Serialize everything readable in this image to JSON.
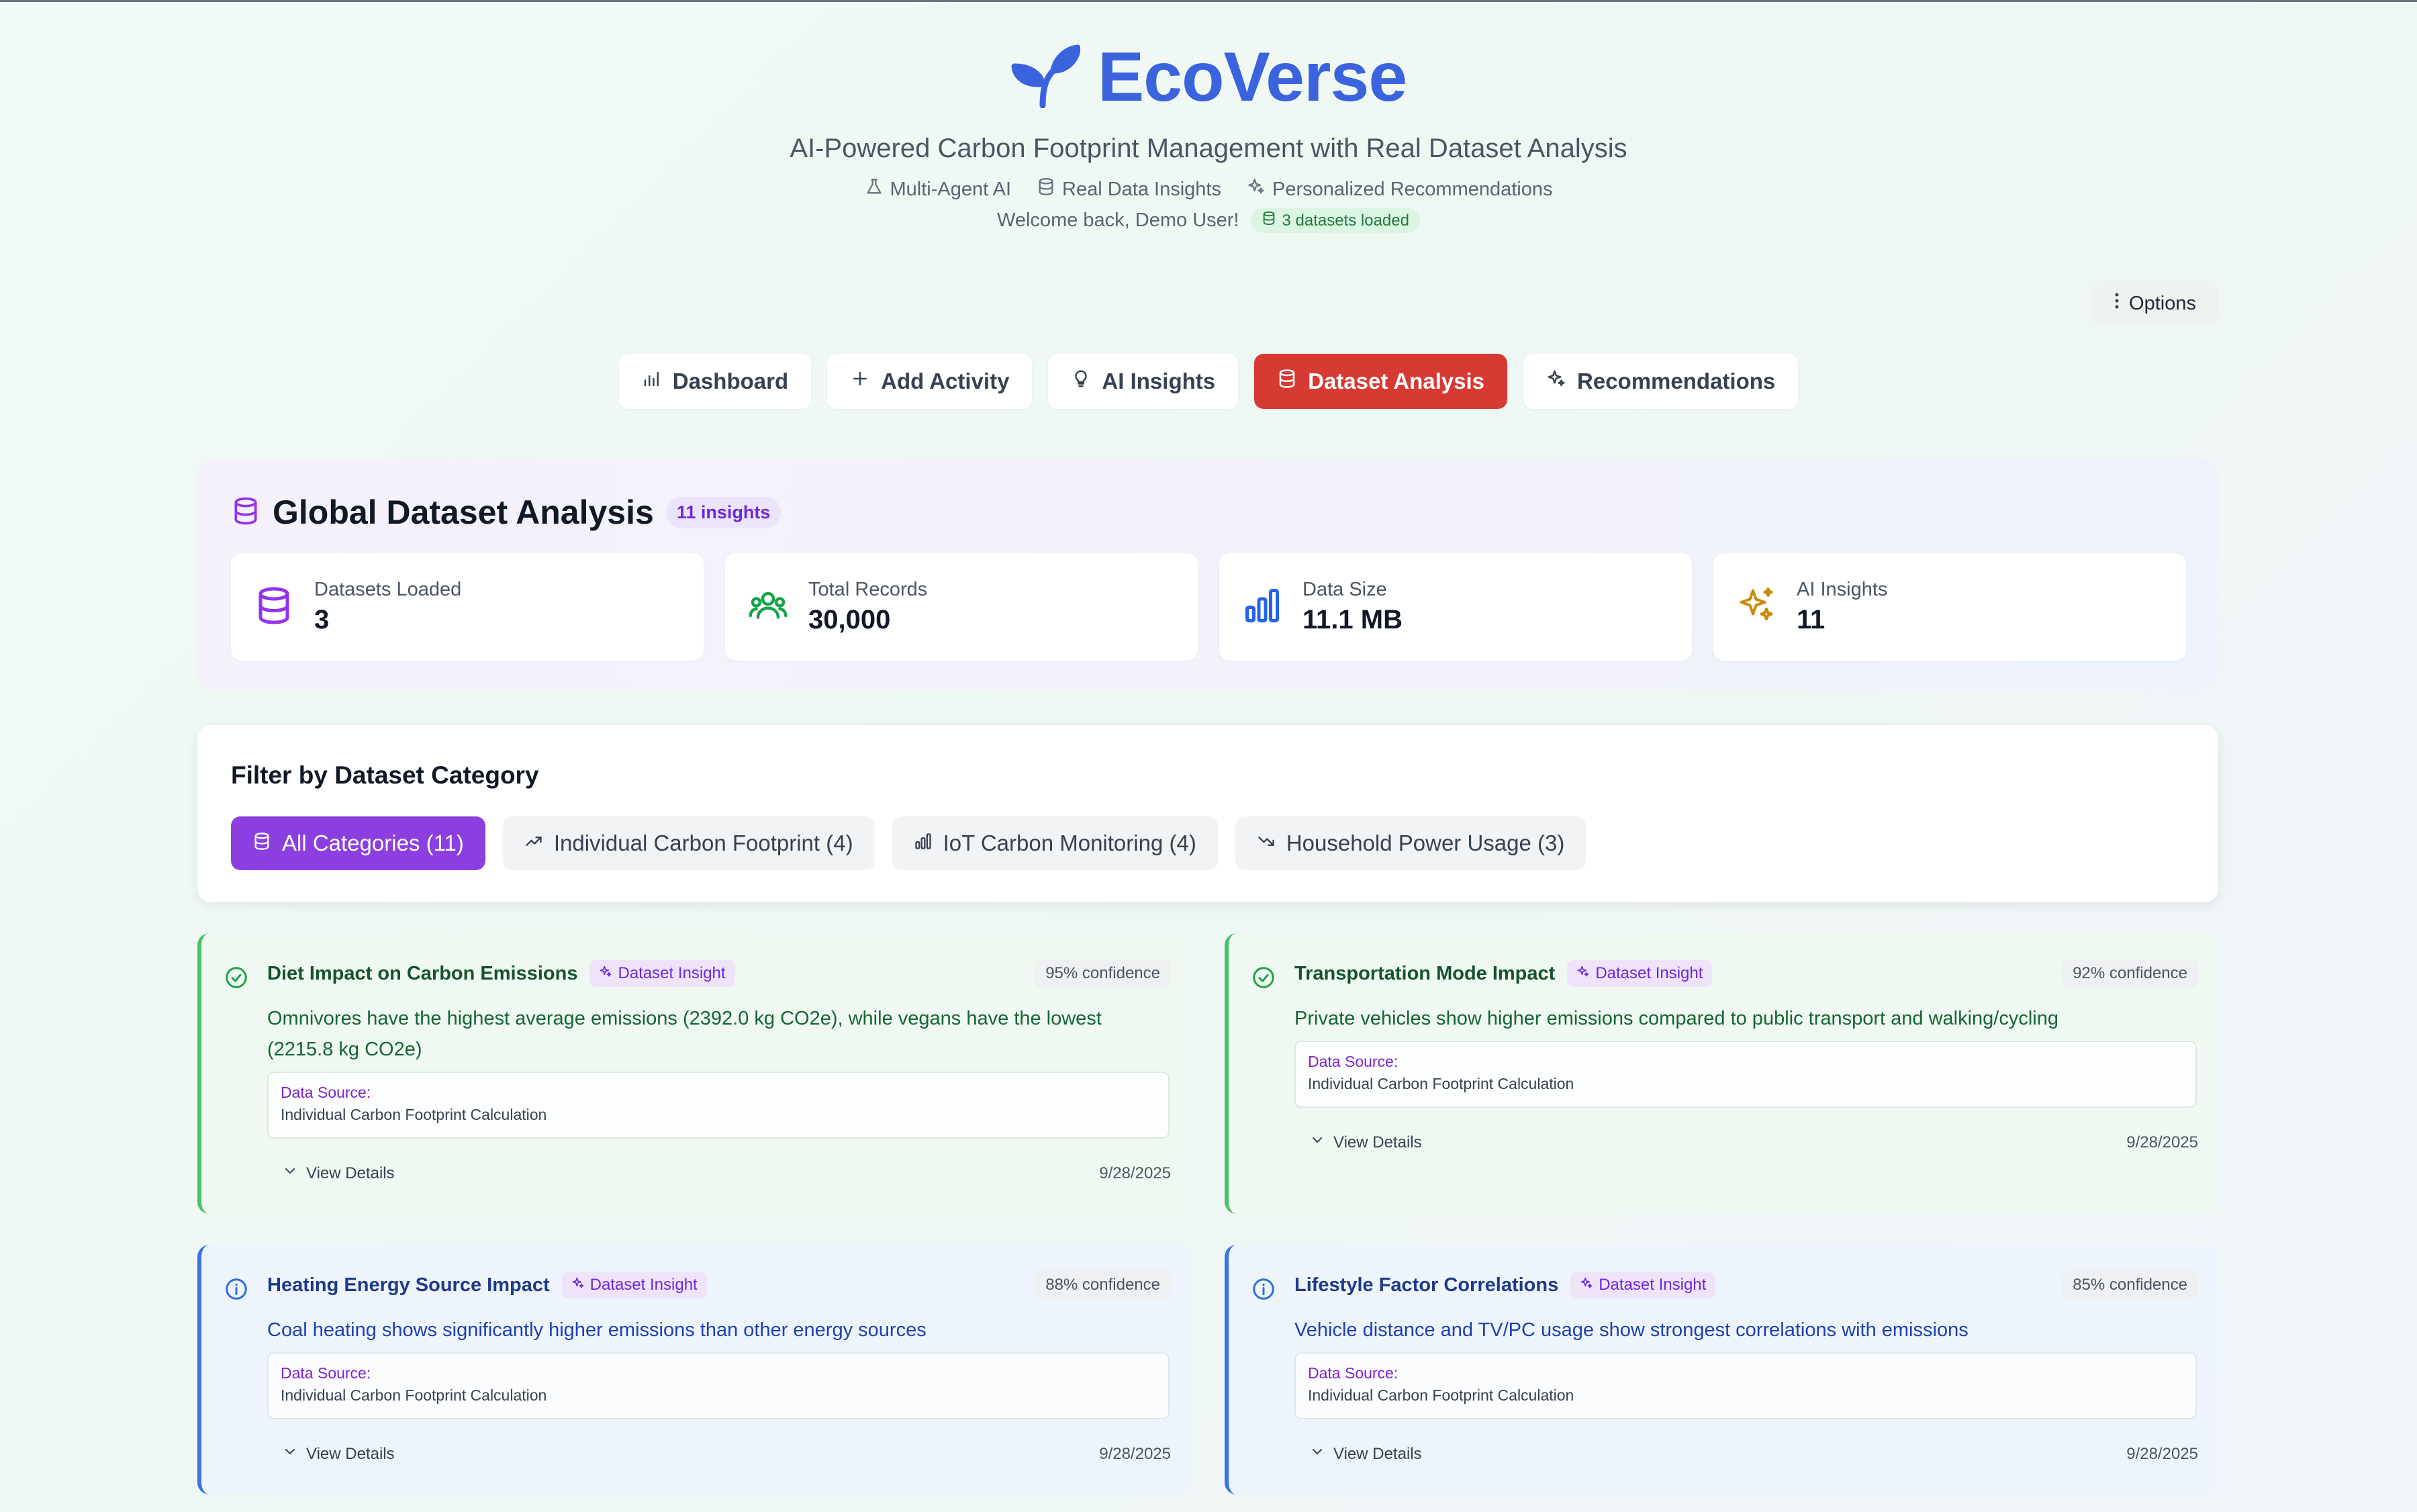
{
  "header": {
    "brand": "EcoVerse",
    "subtitle": "AI-Powered Carbon Footprint Management with Real Dataset Analysis",
    "features": [
      "Multi-Agent AI",
      "Real Data Insights",
      "Personalized Recommendations"
    ],
    "welcome": "Welcome back, Demo User!",
    "datasets_badge": "3 datasets loaded"
  },
  "options_label": "Options",
  "tabs": [
    {
      "label": "Dashboard",
      "icon": "bar-chart-icon"
    },
    {
      "label": "Add Activity",
      "icon": "plus-icon"
    },
    {
      "label": "AI Insights",
      "icon": "lightbulb-icon"
    },
    {
      "label": "Dataset Analysis",
      "icon": "database-icon",
      "active": true
    },
    {
      "label": "Recommendations",
      "icon": "sparkles-icon"
    }
  ],
  "global": {
    "title": "Global Dataset Analysis",
    "badge": "11 insights",
    "stats": [
      {
        "label": "Datasets Loaded",
        "value": "3",
        "icon": "database-icon",
        "color": "#9333ea"
      },
      {
        "label": "Total Records",
        "value": "30,000",
        "icon": "users-icon",
        "color": "#16a34a"
      },
      {
        "label": "Data Size",
        "value": "11.1 MB",
        "icon": "bar-chart-icon",
        "color": "#2563eb"
      },
      {
        "label": "AI Insights",
        "value": "11",
        "icon": "sparkles-icon",
        "color": "#ca8a04"
      }
    ]
  },
  "filter": {
    "title": "Filter by Dataset Category",
    "chips": [
      {
        "label": "All Categories (11)",
        "icon": "database-icon",
        "active": true
      },
      {
        "label": "Individual Carbon Footprint (4)",
        "icon": "trending-up-icon"
      },
      {
        "label": "IoT Carbon Monitoring (4)",
        "icon": "bar-chart-icon"
      },
      {
        "label": "Household Power Usage (3)",
        "icon": "trending-down-icon"
      }
    ]
  },
  "insights": [
    {
      "title": "Diet Impact on Carbon Emissions",
      "badge": "Dataset Insight",
      "confidence": "95% confidence",
      "description": "Omnivores have the highest average emissions (2392.0 kg CO2e), while vegans have the lowest (2215.8 kg CO2e)",
      "source_label": "Data Source:",
      "source": "Individual Carbon Footprint Calculation",
      "details": "View Details",
      "date": "9/28/2025",
      "tone": "green",
      "status_icon": "check-circle-icon"
    },
    {
      "title": "Transportation Mode Impact",
      "badge": "Dataset Insight",
      "confidence": "92% confidence",
      "description": "Private vehicles show higher emissions compared to public transport and walking/cycling",
      "source_label": "Data Source:",
      "source": "Individual Carbon Footprint Calculation",
      "details": "View Details",
      "date": "9/28/2025",
      "tone": "green",
      "status_icon": "check-circle-icon"
    },
    {
      "title": "Heating Energy Source Impact",
      "badge": "Dataset Insight",
      "confidence": "88% confidence",
      "description": "Coal heating shows significantly higher emissions than other energy sources",
      "source_label": "Data Source:",
      "source": "Individual Carbon Footprint Calculation",
      "details": "View Details",
      "date": "9/28/2025",
      "tone": "blue",
      "status_icon": "info-circle-icon"
    },
    {
      "title": "Lifestyle Factor Correlations",
      "badge": "Dataset Insight",
      "confidence": "85% confidence",
      "description": "Vehicle distance and TV/PC usage show strongest correlations with emissions",
      "source_label": "Data Source:",
      "source": "Individual Carbon Footprint Calculation",
      "details": "View Details",
      "date": "9/28/2025",
      "tone": "blue",
      "status_icon": "info-circle-icon"
    }
  ]
}
